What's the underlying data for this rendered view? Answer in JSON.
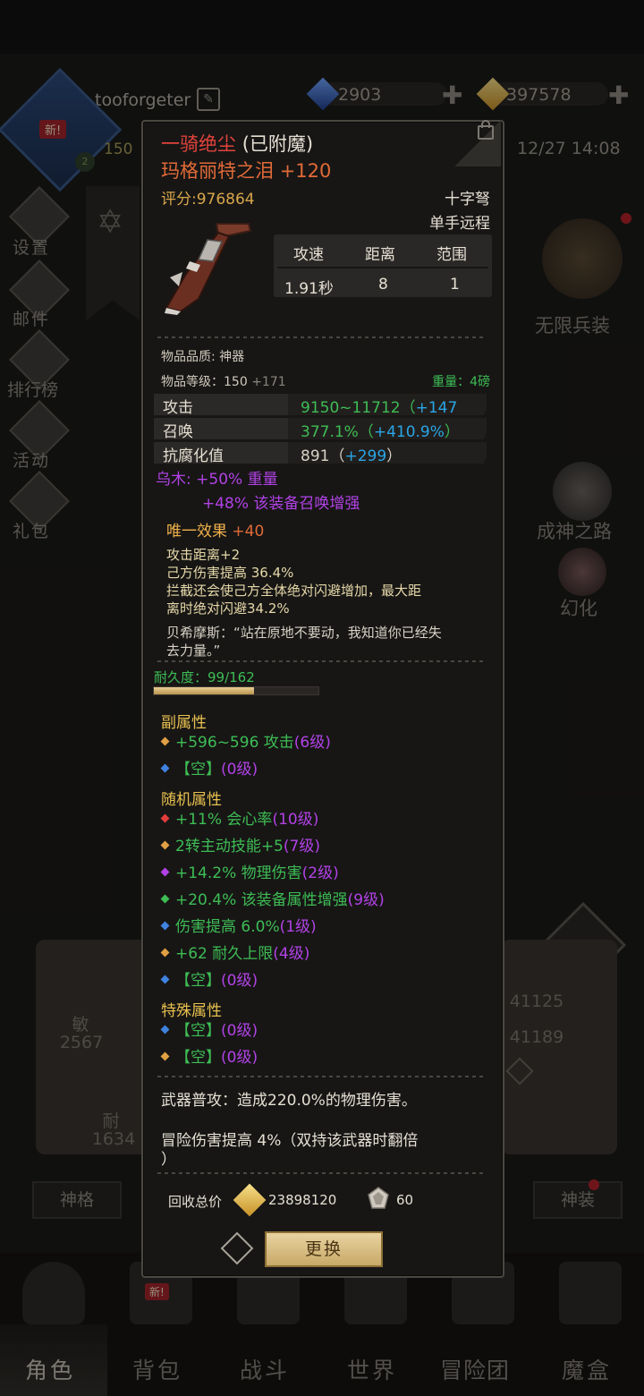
{
  "header": {
    "username": "tooforgeter",
    "new_badge": "新!",
    "level": "150",
    "currency_blue": "2903",
    "currency_gold": "397578",
    "clock": "12/27 14:08"
  },
  "left_menu": [
    "设置",
    "邮件",
    "排行榜",
    "活动",
    "礼包"
  ],
  "right_menu": {
    "infinite_gear": "无限兵装",
    "god_path": "成神之路",
    "transform": "幻化"
  },
  "stats_bg": {
    "agi_label": "敏",
    "agi_value": "2567",
    "end_label": "耐",
    "end_value": "1634",
    "right_val_1": "41125",
    "right_val_2": "41189",
    "left_btn": "神格",
    "right_btn": "神装"
  },
  "bottom_nav": [
    "角色",
    "背包",
    "战斗",
    "世界",
    "冒险团",
    "魔盒"
  ],
  "item": {
    "name": "一骑绝尘",
    "name_suffix": "(已附魔)",
    "enchant_name": "玛格丽特之泪",
    "enchant_value": "+120",
    "score": "评分:976864",
    "type": "十字弩",
    "hand": "单手远程",
    "spec_headers": [
      "攻速",
      "距离",
      "范围"
    ],
    "spec_values": [
      "1.91秒",
      "8",
      "1"
    ],
    "quality": "物品品质: 神器",
    "level_label": "物品等级：150",
    "level_bonus": "+171",
    "weight": "重量：4磅",
    "stats": [
      {
        "name": "攻击",
        "value": "9150~11712",
        "bonus": "+147",
        "paren_open": "（",
        "paren_close": ""
      },
      {
        "name": "召唤",
        "value": "377.1%",
        "bonus": "+410.9%",
        "paren_open": "（",
        "paren_close": "）"
      },
      {
        "name": "抗腐化值",
        "value": "891",
        "bonus": "+299",
        "paren_open": "（",
        "paren_close": "）"
      }
    ],
    "material_line1": "乌木: +50% 重量",
    "material_line2": "+48% 该装备召唤增强",
    "unique_label": "唯一效果",
    "unique_value": "+40",
    "effects": [
      "攻击距离+2",
      "己方伤害提高 36.4%",
      "拦截还会使己方全体绝对闪避增加，最大距",
      "离时绝对闪避34.2%"
    ],
    "quote_1": "贝希摩斯：“站在原地不要动，我知道你已经失",
    "quote_2": "去力量。”",
    "durability": "耐久度：99/162",
    "durability_ratio": 0.611,
    "sub_title": "副属性",
    "sub_attrs": [
      {
        "text": "+596~596 攻击",
        "level": "(6级)",
        "gem": "#e1a043",
        "text_color": "#3ebd55"
      },
      {
        "text": "【空】",
        "level": "(0级)",
        "gem": "#3f82e0",
        "text_color": "#3ebd55"
      }
    ],
    "rand_title": "随机属性",
    "rand_attrs": [
      {
        "text": "+11% 会心率",
        "level": "(10级)",
        "gem": "#e23c3c",
        "text_color": "#3ebd55"
      },
      {
        "text": "2转主动技能+5",
        "level": "(7级)",
        "gem": "#e1a043",
        "text_color": "#3ebd55"
      },
      {
        "text": "+14.2% 物理伤害",
        "level": "(2级)",
        "gem": "#b242e6",
        "text_color": "#3ebd55"
      },
      {
        "text": "+20.4% 该装备属性增强",
        "level": "(9级)",
        "gem": "#3ebd55",
        "text_color": "#3ebd55"
      },
      {
        "text": "伤害提高 6.0%",
        "level": "(1级)",
        "gem": "#3f82e0",
        "text_color": "#3ebd55"
      },
      {
        "text": "+62 耐久上限",
        "level": "(4级)",
        "gem": "#e1a043",
        "text_color": "#3ebd55"
      },
      {
        "text": "【空】",
        "level": "(0级)",
        "gem": "#3f82e0",
        "text_color": "#3ebd55"
      }
    ],
    "special_title": "特殊属性",
    "special_attrs": [
      {
        "text": "【空】",
        "level": "(0级)",
        "gem": "#3f82e0",
        "text_color": "#3ebd55"
      },
      {
        "text": "【空】",
        "level": "(0级)",
        "gem": "#e1a043",
        "text_color": "#3ebd55"
      }
    ],
    "weapon_attack": "武器普攻：造成220.0%的物理伤害。",
    "adventure_1": "冒险伤害提高 4%（双持该武器时翻倍",
    "adventure_2": "）",
    "recycle_label": "回收总价",
    "recycle_gold": "23898120",
    "recycle_shard": "60",
    "replace_label": "更换"
  },
  "colors": {
    "level_purple": "#b242e6",
    "stat_green": "#3ebd55",
    "stat_blue": "#2aa5e6",
    "enchant_orange": "#e06a38",
    "title_gold": "#e8c04f"
  }
}
